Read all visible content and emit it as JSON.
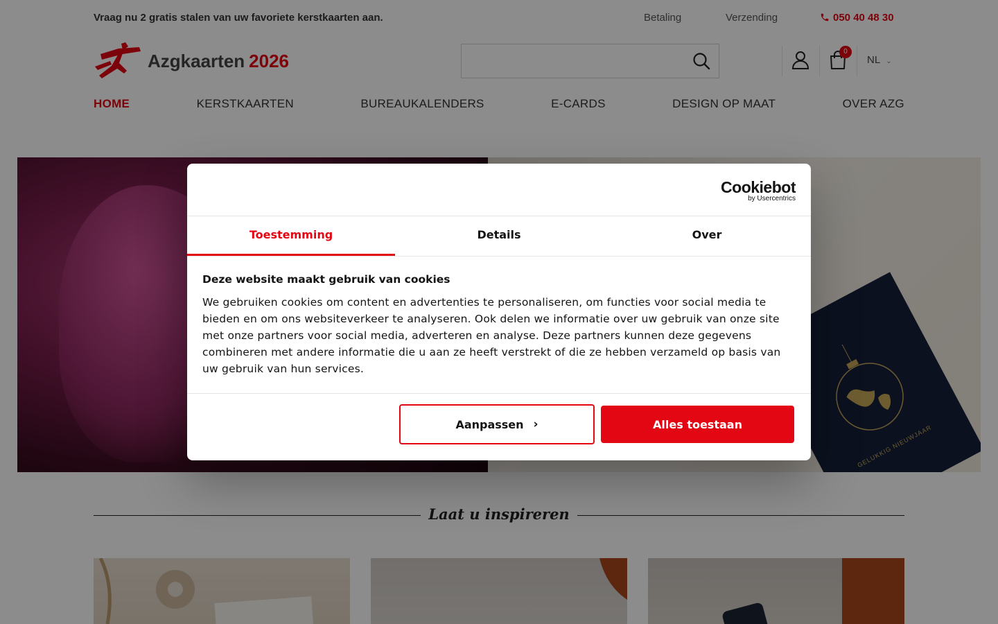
{
  "topbar": {
    "promo": "Vraag nu 2 gratis stalen van uw favoriete kerstkaarten aan.",
    "payment_label": "Betaling",
    "shipping_label": "Verzending",
    "phone": "050 40 48 30"
  },
  "header": {
    "brand": "Azgkaarten",
    "year": "2026",
    "search_placeholder": "",
    "cart_count": "0",
    "language": "NL"
  },
  "nav": {
    "items": [
      "HOME",
      "KERSTKAARTEN",
      "BUREAUKALENDERS",
      "E-CARDS",
      "DESIGN OP MAAT",
      "OVER AZG"
    ],
    "active": "HOME"
  },
  "hero": {
    "card_text": "GELUKKIG NIEUWJAAR"
  },
  "cookie_dialog": {
    "logo_main": "Cookiebot",
    "logo_sub": "by Usercentrics",
    "tabs": [
      "Toestemming",
      "Details",
      "Over"
    ],
    "active_tab": "Toestemming",
    "heading": "Deze website maakt gebruik van cookies",
    "body": "We gebruiken cookies om content en advertenties te personaliseren, om functies voor social media te bieden en om ons websiteverkeer te analyseren. Ook delen we informatie over uw gebruik van onze site met onze partners voor social media, adverteren en analyse. Deze partners kunnen deze gegevens combineren met andere informatie die u aan ze heeft verstrekt of die ze hebben verzameld op basis van uw gebruik van hun services.",
    "customize_label": "Aanpassen",
    "allow_all_label": "Alles toestaan"
  },
  "inspiration": {
    "title": "Laat u inspireren"
  },
  "colors": {
    "accent": "#e30613",
    "text": "#141414"
  }
}
